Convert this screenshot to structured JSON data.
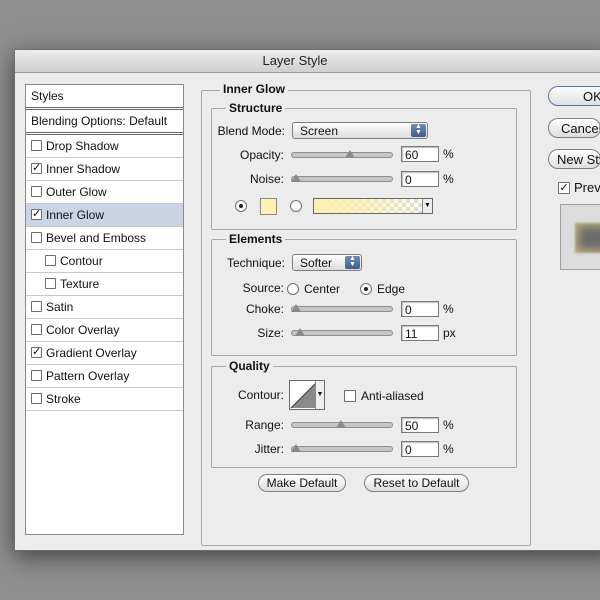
{
  "window": {
    "title": "Layer Style"
  },
  "styles": {
    "header": "Styles",
    "blending_options": "Blending Options: Default",
    "items": [
      {
        "label": "Drop Shadow",
        "checked": false,
        "indent": 0,
        "selected": false
      },
      {
        "label": "Inner Shadow",
        "checked": true,
        "indent": 0,
        "selected": false
      },
      {
        "label": "Outer Glow",
        "checked": false,
        "indent": 0,
        "selected": false
      },
      {
        "label": "Inner Glow",
        "checked": true,
        "indent": 0,
        "selected": true
      },
      {
        "label": "Bevel and Emboss",
        "checked": false,
        "indent": 0,
        "selected": false
      },
      {
        "label": "Contour",
        "checked": false,
        "indent": 1,
        "selected": false
      },
      {
        "label": "Texture",
        "checked": false,
        "indent": 1,
        "selected": false
      },
      {
        "label": "Satin",
        "checked": false,
        "indent": 0,
        "selected": false
      },
      {
        "label": "Color Overlay",
        "checked": false,
        "indent": 0,
        "selected": false
      },
      {
        "label": "Gradient Overlay",
        "checked": true,
        "indent": 0,
        "selected": false
      },
      {
        "label": "Pattern Overlay",
        "checked": false,
        "indent": 0,
        "selected": false
      },
      {
        "label": "Stroke",
        "checked": false,
        "indent": 0,
        "selected": false
      }
    ]
  },
  "inner_glow": {
    "title": "Inner Glow",
    "structure": {
      "title": "Structure",
      "blend_mode_label": "Blend Mode:",
      "blend_mode_value": "Screen",
      "opacity_label": "Opacity:",
      "opacity_value": "60",
      "opacity_unit": "%",
      "opacity_fraction": 0.6,
      "noise_label": "Noise:",
      "noise_value": "0",
      "noise_unit": "%",
      "noise_fraction": 0.0,
      "glow_color": "#fdf2b3"
    },
    "elements": {
      "title": "Elements",
      "technique_label": "Technique:",
      "technique_value": "Softer",
      "source_label": "Source:",
      "source_center": "Center",
      "source_edge": "Edge",
      "source_selected": "Edge",
      "choke_label": "Choke:",
      "choke_value": "0",
      "choke_unit": "%",
      "choke_fraction": 0.0,
      "size_label": "Size:",
      "size_value": "11",
      "size_unit": "px",
      "size_fraction": 0.044
    },
    "quality": {
      "title": "Quality",
      "contour_label": "Contour:",
      "anti_aliased_label": "Anti-aliased",
      "anti_aliased": false,
      "range_label": "Range:",
      "range_value": "50",
      "range_unit": "%",
      "range_fraction": 0.5,
      "jitter_label": "Jitter:",
      "jitter_value": "0",
      "jitter_unit": "%",
      "jitter_fraction": 0.0
    },
    "make_default": "Make Default",
    "reset_to_default": "Reset to Default"
  },
  "buttons": {
    "ok": "OK",
    "cancel": "Cancel",
    "new_style": "New Style...",
    "preview": "Preview",
    "preview_checked": true
  }
}
